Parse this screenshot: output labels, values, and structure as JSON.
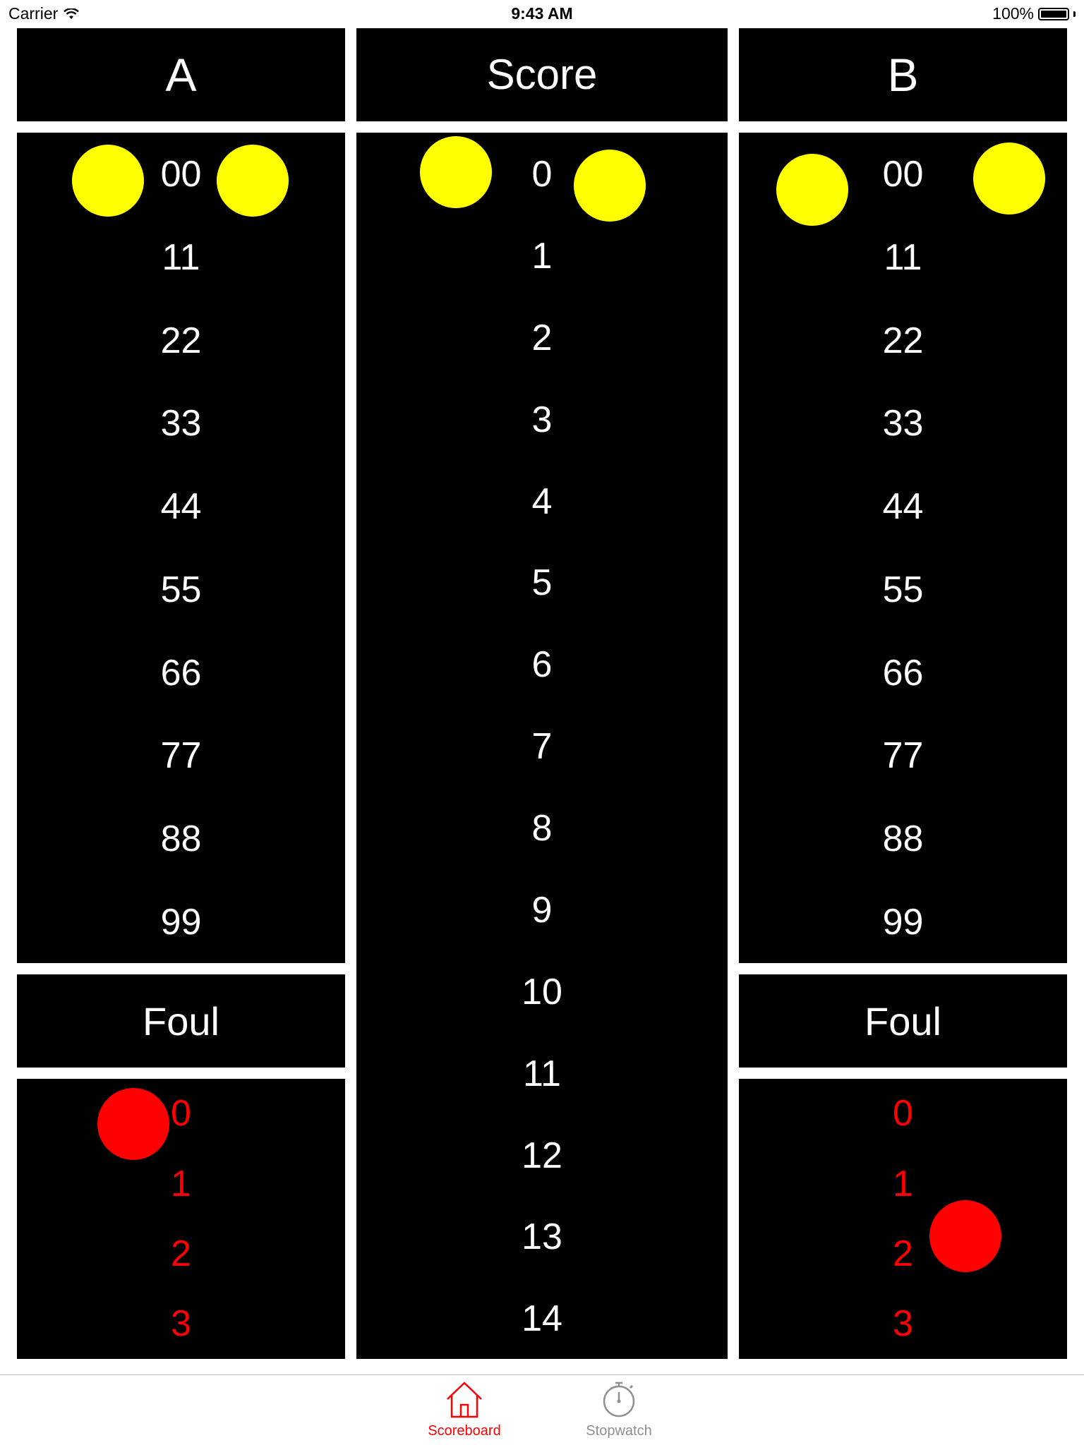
{
  "status_bar": {
    "carrier": "Carrier",
    "time": "9:43 AM",
    "battery": "100%"
  },
  "team_a": {
    "title": "A",
    "scores": [
      "00",
      "11",
      "22",
      "33",
      "44",
      "55",
      "66",
      "77",
      "88",
      "99"
    ],
    "foul_title": "Foul",
    "fouls": [
      "0",
      "1",
      "2",
      "3"
    ]
  },
  "score_column": {
    "title": "Score",
    "values": [
      "0",
      "1",
      "2",
      "3",
      "4",
      "5",
      "6",
      "7",
      "8",
      "9",
      "10",
      "11",
      "12",
      "13",
      "14"
    ]
  },
  "team_b": {
    "title": "B",
    "scores": [
      "00",
      "11",
      "22",
      "33",
      "44",
      "55",
      "66",
      "77",
      "88",
      "99"
    ],
    "foul_title": "Foul",
    "fouls": [
      "0",
      "1",
      "2",
      "3"
    ]
  },
  "tabs": [
    {
      "label": "Scoreboard",
      "icon": "house-icon",
      "selected": true
    },
    {
      "label": "Stopwatch",
      "icon": "stopwatch-icon",
      "selected": false
    }
  ],
  "colors": {
    "accent": "#ff0000",
    "inactive": "#8e8e93",
    "marker_yellow": "#ffff00",
    "marker_red": "#ff0000"
  }
}
